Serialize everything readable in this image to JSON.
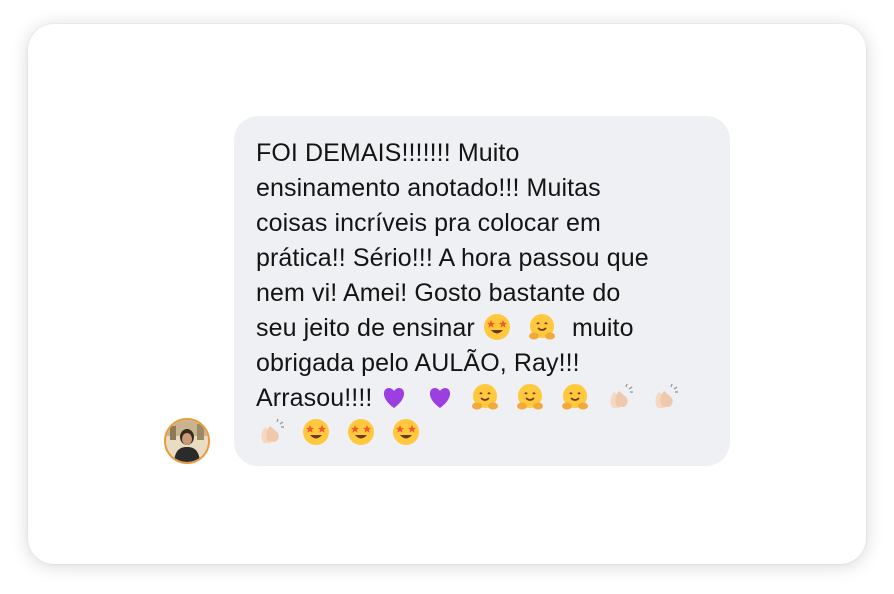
{
  "conversation": {
    "sender_avatar": "avatar-photo",
    "message": {
      "lines": [
        "FOI DEMAIS!!!!!!! Muito",
        "ensinamento anotado!!! Muitas",
        "coisas incríveis pra colocar em",
        "prática!! Sério!!! A hora passou que",
        "nem vi! Amei! Gosto bastante do",
        "seu jeito de ensinar",
        "muito",
        "obrigada pelo AULÃO, Ray!!!",
        "Arrasou!!!!"
      ],
      "emoji_sequence_line6": [
        "star-struck-emoji",
        "hugging-face-emoji"
      ],
      "emoji_sequence_line8": [
        "purple-heart-emoji",
        "purple-heart-emoji",
        "hugging-face-emoji",
        "hugging-face-emoji",
        "hugging-face-emoji",
        "clapping-hands-emoji",
        "clapping-hands-emoji"
      ],
      "emoji_sequence_line9": [
        "clapping-hands-emoji",
        "star-struck-emoji",
        "star-struck-emoji",
        "star-struck-emoji"
      ]
    },
    "colors": {
      "bubble_background": "#eef0f3",
      "text": "#141414",
      "avatar_border": "#e89a3c"
    }
  }
}
